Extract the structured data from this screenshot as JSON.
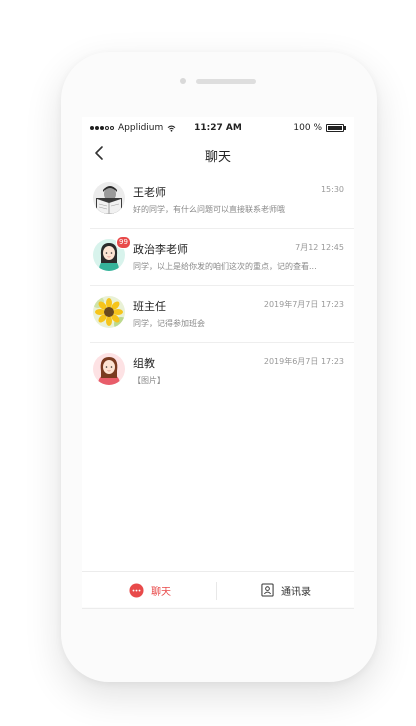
{
  "status_bar": {
    "carrier": "Applidium",
    "time": "11:27 AM",
    "battery": "100 %"
  },
  "header": {
    "title": "聊天",
    "back_icon": "chevron-left-icon"
  },
  "chats": [
    {
      "name": "王老师",
      "time": "15:30",
      "preview": "好的同学，有什么问题可以直接联系老师哦",
      "badge": ""
    },
    {
      "name": "政治李老师",
      "time": "7月12  12:45",
      "preview": "同学，以上是给你发的咱们这次的重点，记的查看...",
      "badge": "99"
    },
    {
      "name": "班主任",
      "time": "2019年7月7日  17:23",
      "preview": "同学，记得参加班会",
      "badge": ""
    },
    {
      "name": "组教",
      "time": "2019年6月7日  17:23",
      "preview": "【图片】",
      "badge": ""
    }
  ],
  "tabs": [
    {
      "label": "聊天",
      "icon": "chat-bubble-icon",
      "active": true
    },
    {
      "label": "通讯录",
      "icon": "contacts-icon",
      "active": false
    }
  ],
  "colors": {
    "accent": "#e84a4a",
    "text": "#222222",
    "muted": "#888888"
  }
}
